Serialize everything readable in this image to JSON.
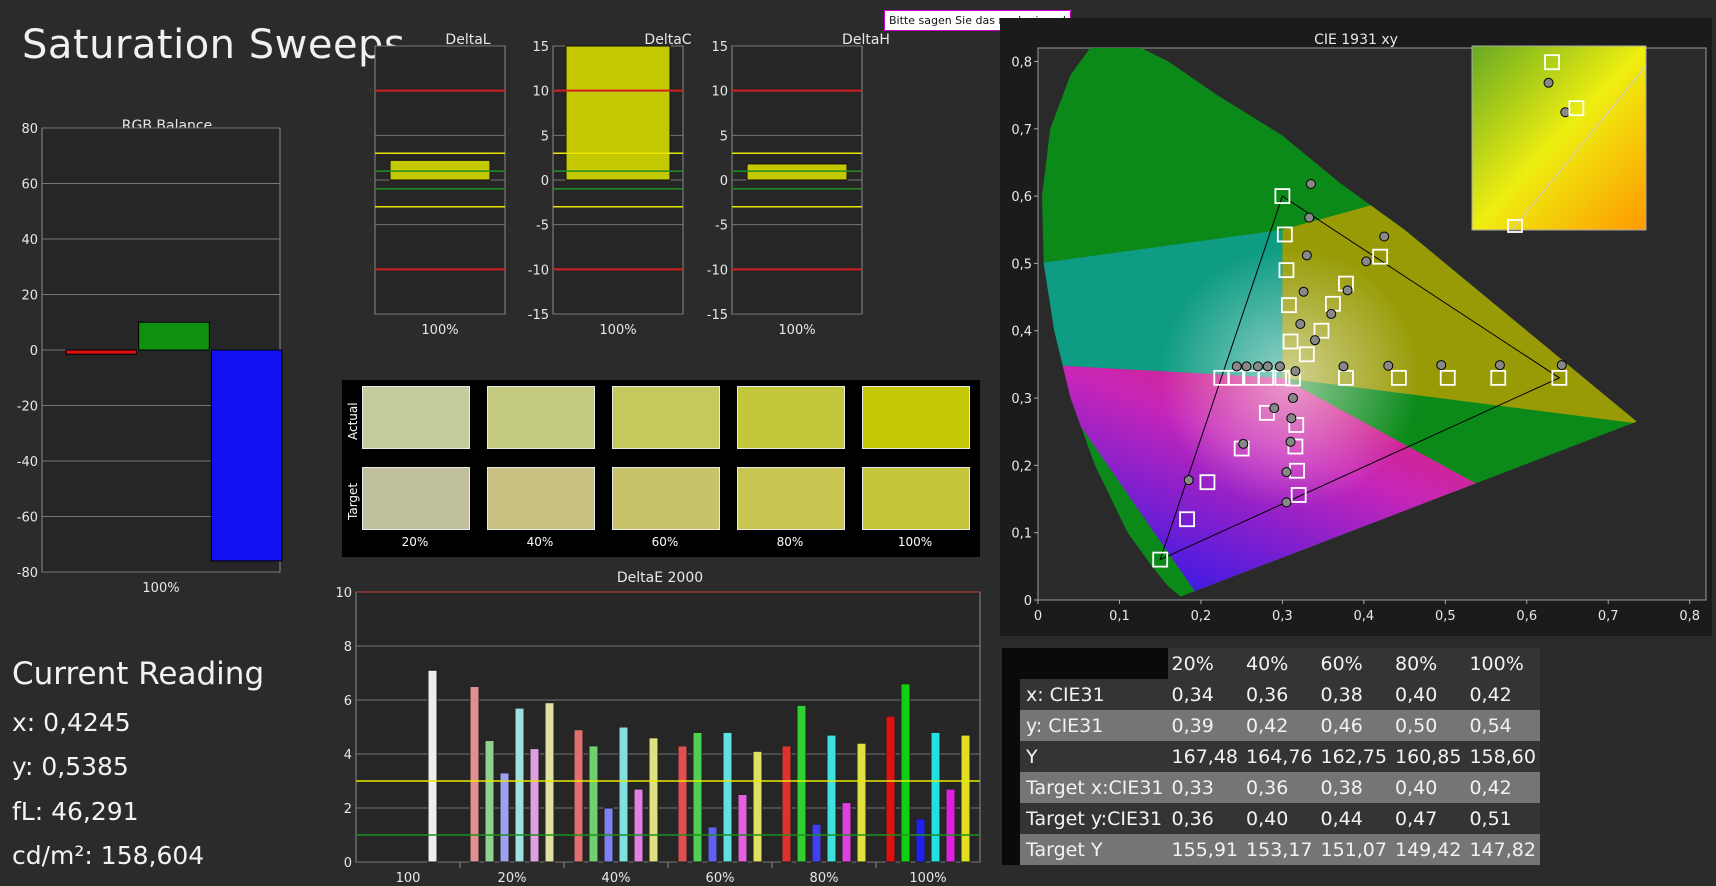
{
  "title": "Saturation Sweeps",
  "tooltip": "Bitte sagen Sie das noch einmal",
  "current_reading": {
    "title": "Current Reading",
    "x": "x: 0,4245",
    "y": "y: 0,5385",
    "fl": "fL: 46,291",
    "cdm2": "cd/m²: 158,604"
  },
  "swatches": {
    "actual_label": "Actual",
    "target_label": "Target",
    "labels": [
      "20%",
      "40%",
      "60%",
      "80%",
      "100%"
    ],
    "actual_colors": [
      "#c3cc9c",
      "#c3ca7e",
      "#c3c95c",
      "#c3c83a",
      "#c4c805"
    ],
    "target_colors": [
      "#c0c09c",
      "#c8c282",
      "#c8c26a",
      "#c8c650",
      "#c6c63c"
    ]
  },
  "colors": {
    "red_line": "#d42020",
    "yellow_line": "#e8e800",
    "green_line": "#1f8f1f",
    "panel_bg": "#262626",
    "grid": "#8a8a8a"
  },
  "table": {
    "header": [
      "",
      "20%",
      "40%",
      "60%",
      "80%",
      "100%"
    ],
    "rows": [
      {
        "label": "x: CIE31",
        "values": [
          "0,34",
          "0,36",
          "0,38",
          "0,40",
          "0,42"
        ]
      },
      {
        "label": "y: CIE31",
        "values": [
          "0,39",
          "0,42",
          "0,46",
          "0,50",
          "0,54"
        ]
      },
      {
        "label": "Y",
        "values": [
          "167,48",
          "164,76",
          "162,75",
          "160,85",
          "158,60"
        ]
      },
      {
        "label": "Target x:CIE31",
        "values": [
          "0,33",
          "0,36",
          "0,38",
          "0,40",
          "0,42"
        ]
      },
      {
        "label": "Target y:CIE31",
        "values": [
          "0,36",
          "0,40",
          "0,44",
          "0,47",
          "0,51"
        ]
      },
      {
        "label": "Target Y",
        "values": [
          "155,91",
          "153,17",
          "151,07",
          "149,42",
          "147,82"
        ]
      }
    ]
  },
  "chart_data": [
    {
      "id": "rgb_balance",
      "type": "bar",
      "title": "RGB Balance",
      "categories": [
        "100%"
      ],
      "ylim": [
        -80,
        80
      ],
      "yticks": [
        80,
        60,
        40,
        20,
        0,
        -20,
        -40,
        -60,
        -80
      ],
      "series": [
        {
          "color": "#e01010",
          "values": [
            -1.5
          ]
        },
        {
          "color": "#109010",
          "values": [
            10
          ]
        },
        {
          "color": "#1010f0",
          "values": [
            -76
          ]
        }
      ]
    },
    {
      "id": "deltaL",
      "type": "bar",
      "title": "DeltaL",
      "categories": [
        "100%"
      ],
      "ylim": [
        -15,
        15
      ],
      "yticks": [
        15,
        10,
        5,
        0,
        -5,
        -10,
        -15
      ],
      "values": [
        2.2
      ],
      "red_lines": [
        10,
        -10
      ],
      "yellow_lines": [
        3,
        -3
      ],
      "green_lines": [
        1,
        -1
      ]
    },
    {
      "id": "deltaC",
      "type": "bar",
      "title": "DeltaC",
      "categories": [
        "100%"
      ],
      "ylim": [
        -15,
        15
      ],
      "yticks": [
        15,
        10,
        5,
        0,
        -5,
        -10,
        -15
      ],
      "values": [
        15.5
      ],
      "red_lines": [
        10,
        -10
      ],
      "yellow_lines": [
        3,
        -3
      ],
      "green_lines": [
        1,
        -1
      ]
    },
    {
      "id": "deltaH",
      "type": "bar",
      "title": "DeltaH",
      "categories": [
        "100%"
      ],
      "ylim": [
        -15,
        15
      ],
      "yticks": [
        15,
        10,
        5,
        0,
        -5,
        -10,
        -15
      ],
      "values": [
        1.8
      ],
      "red_lines": [
        10,
        -10
      ],
      "yellow_lines": [
        3,
        -3
      ],
      "green_lines": [
        1,
        -1
      ]
    },
    {
      "id": "deltaE",
      "type": "bar",
      "title": "DeltaE 2000",
      "categories": [
        "100",
        "20%",
        "40%",
        "60%",
        "80%",
        "100%"
      ],
      "ylim": [
        0,
        10
      ],
      "yticks": [
        10,
        8,
        6,
        4,
        2,
        0
      ],
      "threshold_yellow": 3,
      "threshold_green": 1,
      "groups": [
        {
          "category": "100",
          "bars": [
            {
              "color": "#eeeeee",
              "value": 7.1
            }
          ]
        },
        {
          "category": "20%",
          "bars": [
            {
              "color": "#e09090",
              "value": 6.5
            },
            {
              "color": "#90d090",
              "value": 4.5
            },
            {
              "color": "#a0a0f0",
              "value": 3.3
            },
            {
              "color": "#a0e0e0",
              "value": 5.7
            },
            {
              "color": "#e0a0e0",
              "value": 4.2
            },
            {
              "color": "#e0e0a0",
              "value": 5.9
            }
          ]
        },
        {
          "category": "40%",
          "bars": [
            {
              "color": "#e07070",
              "value": 4.9
            },
            {
              "color": "#70d070",
              "value": 4.3
            },
            {
              "color": "#8080f0",
              "value": 2.0
            },
            {
              "color": "#80e0e0",
              "value": 5.0
            },
            {
              "color": "#e080e0",
              "value": 2.7
            },
            {
              "color": "#e0e080",
              "value": 4.6
            }
          ]
        },
        {
          "category": "60%",
          "bars": [
            {
              "color": "#e05050",
              "value": 4.3
            },
            {
              "color": "#50d050",
              "value": 4.8
            },
            {
              "color": "#6060f0",
              "value": 1.3
            },
            {
              "color": "#60e0e0",
              "value": 4.8
            },
            {
              "color": "#e060e0",
              "value": 2.5
            },
            {
              "color": "#e0e060",
              "value": 4.1
            }
          ]
        },
        {
          "category": "80%",
          "bars": [
            {
              "color": "#e03030",
              "value": 4.3
            },
            {
              "color": "#30d030",
              "value": 5.8
            },
            {
              "color": "#4040f0",
              "value": 1.4
            },
            {
              "color": "#40e0e0",
              "value": 4.7
            },
            {
              "color": "#e040e0",
              "value": 2.2
            },
            {
              "color": "#e0e040",
              "value": 4.4
            }
          ]
        },
        {
          "category": "100%",
          "bars": [
            {
              "color": "#e01010",
              "value": 5.4
            },
            {
              "color": "#10d010",
              "value": 6.6
            },
            {
              "color": "#2020f0",
              "value": 1.6
            },
            {
              "color": "#20e0e0",
              "value": 4.8
            },
            {
              "color": "#e020e0",
              "value": 2.7
            },
            {
              "color": "#e0e020",
              "value": 4.7
            }
          ]
        }
      ]
    },
    {
      "id": "cie1931",
      "type": "scatter",
      "title": "CIE 1931 xy",
      "xlim": [
        0,
        0.82
      ],
      "ylim": [
        0,
        0.82
      ],
      "xticks": [
        "0",
        "0,1",
        "0,2",
        "0,3",
        "0,4",
        "0,5",
        "0,6",
        "0,7",
        "0,8"
      ],
      "yticks": [
        "0,8",
        "0,7",
        "0,6",
        "0,5",
        "0,4",
        "0,3",
        "0,2",
        "0,1",
        "0"
      ],
      "gamut_triangle": [
        [
          0.64,
          0.33
        ],
        [
          0.3,
          0.6
        ],
        [
          0.15,
          0.06
        ]
      ],
      "targets": [
        [
          0.64,
          0.33
        ],
        [
          0.565,
          0.33
        ],
        [
          0.503,
          0.33
        ],
        [
          0.443,
          0.33
        ],
        [
          0.378,
          0.33
        ],
        [
          0.3,
          0.6
        ],
        [
          0.303,
          0.543
        ],
        [
          0.305,
          0.49
        ],
        [
          0.308,
          0.438
        ],
        [
          0.31,
          0.384
        ],
        [
          0.15,
          0.06
        ],
        [
          0.183,
          0.12
        ],
        [
          0.208,
          0.175
        ],
        [
          0.25,
          0.225
        ],
        [
          0.281,
          0.278
        ],
        [
          0.313,
          0.329
        ],
        [
          0.32,
          0.156
        ],
        [
          0.318,
          0.192
        ],
        [
          0.316,
          0.228
        ],
        [
          0.317,
          0.26
        ],
        [
          0.225,
          0.33
        ],
        [
          0.243,
          0.33
        ],
        [
          0.262,
          0.33
        ],
        [
          0.28,
          0.33
        ],
        [
          0.3,
          0.33
        ],
        [
          0.33,
          0.365
        ],
        [
          0.348,
          0.4
        ],
        [
          0.362,
          0.44
        ],
        [
          0.378,
          0.47
        ],
        [
          0.42,
          0.51
        ]
      ],
      "measured": [
        [
          0.643,
          0.349
        ],
        [
          0.567,
          0.349
        ],
        [
          0.495,
          0.349
        ],
        [
          0.43,
          0.348
        ],
        [
          0.375,
          0.347
        ],
        [
          0.335,
          0.618
        ],
        [
          0.333,
          0.568
        ],
        [
          0.33,
          0.512
        ],
        [
          0.326,
          0.458
        ],
        [
          0.322,
          0.41
        ],
        [
          0.185,
          0.178
        ],
        [
          0.252,
          0.232
        ],
        [
          0.29,
          0.285
        ],
        [
          0.305,
          0.145
        ],
        [
          0.305,
          0.19
        ],
        [
          0.31,
          0.235
        ],
        [
          0.313,
          0.3
        ],
        [
          0.311,
          0.27
        ],
        [
          0.244,
          0.347
        ],
        [
          0.256,
          0.347
        ],
        [
          0.27,
          0.347
        ],
        [
          0.282,
          0.347
        ],
        [
          0.297,
          0.347
        ],
        [
          0.316,
          0.34
        ],
        [
          0.34,
          0.386
        ],
        [
          0.36,
          0.425
        ],
        [
          0.38,
          0.46
        ],
        [
          0.403,
          0.503
        ],
        [
          0.425,
          0.54
        ]
      ],
      "inset_points_measured": [
        [
          0.67,
          0.64
        ],
        [
          0.55,
          0.8
        ]
      ],
      "inset_points_target": [
        [
          0.6,
          0.7
        ],
        [
          0.46,
          0.95
        ]
      ]
    }
  ]
}
